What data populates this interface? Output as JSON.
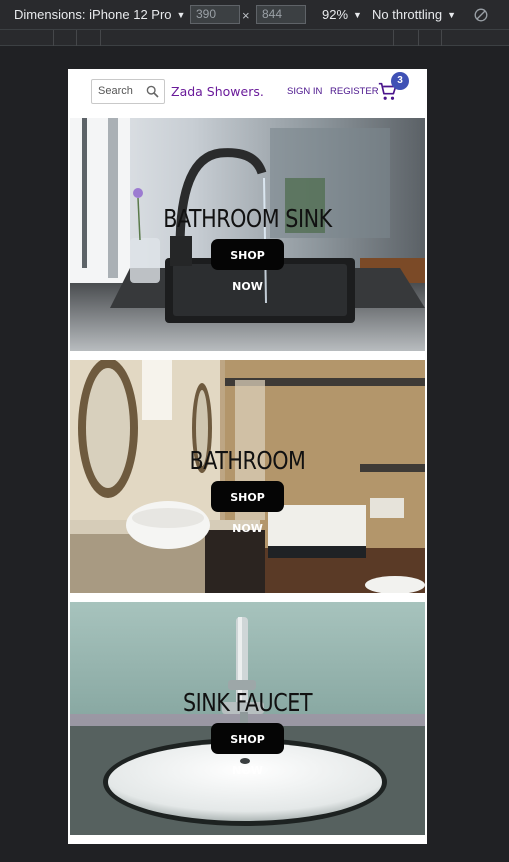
{
  "devtools": {
    "dimensions_label": "Dimensions: iPhone 12 Pro",
    "width_value": "390",
    "height_value": "844",
    "times_symbol": "×",
    "zoom_label": "92%",
    "throttle_label": "No throttling"
  },
  "header": {
    "search_placeholder": "Search",
    "brand": "Zada Showers.",
    "sign_in": "SIGN IN",
    "register": "REGISTER",
    "cart_count": "3"
  },
  "tiles": [
    {
      "title": "BATHROOM SINK",
      "button": "SHOP NOW"
    },
    {
      "title": "BATHROOM",
      "button": "SHOP NOW"
    },
    {
      "title": "SINK FAUCET",
      "button": "SHOP NOW"
    }
  ],
  "colors": {
    "brand": "#6a1b9a",
    "badge": "#3f51b5",
    "button": "#050505"
  }
}
